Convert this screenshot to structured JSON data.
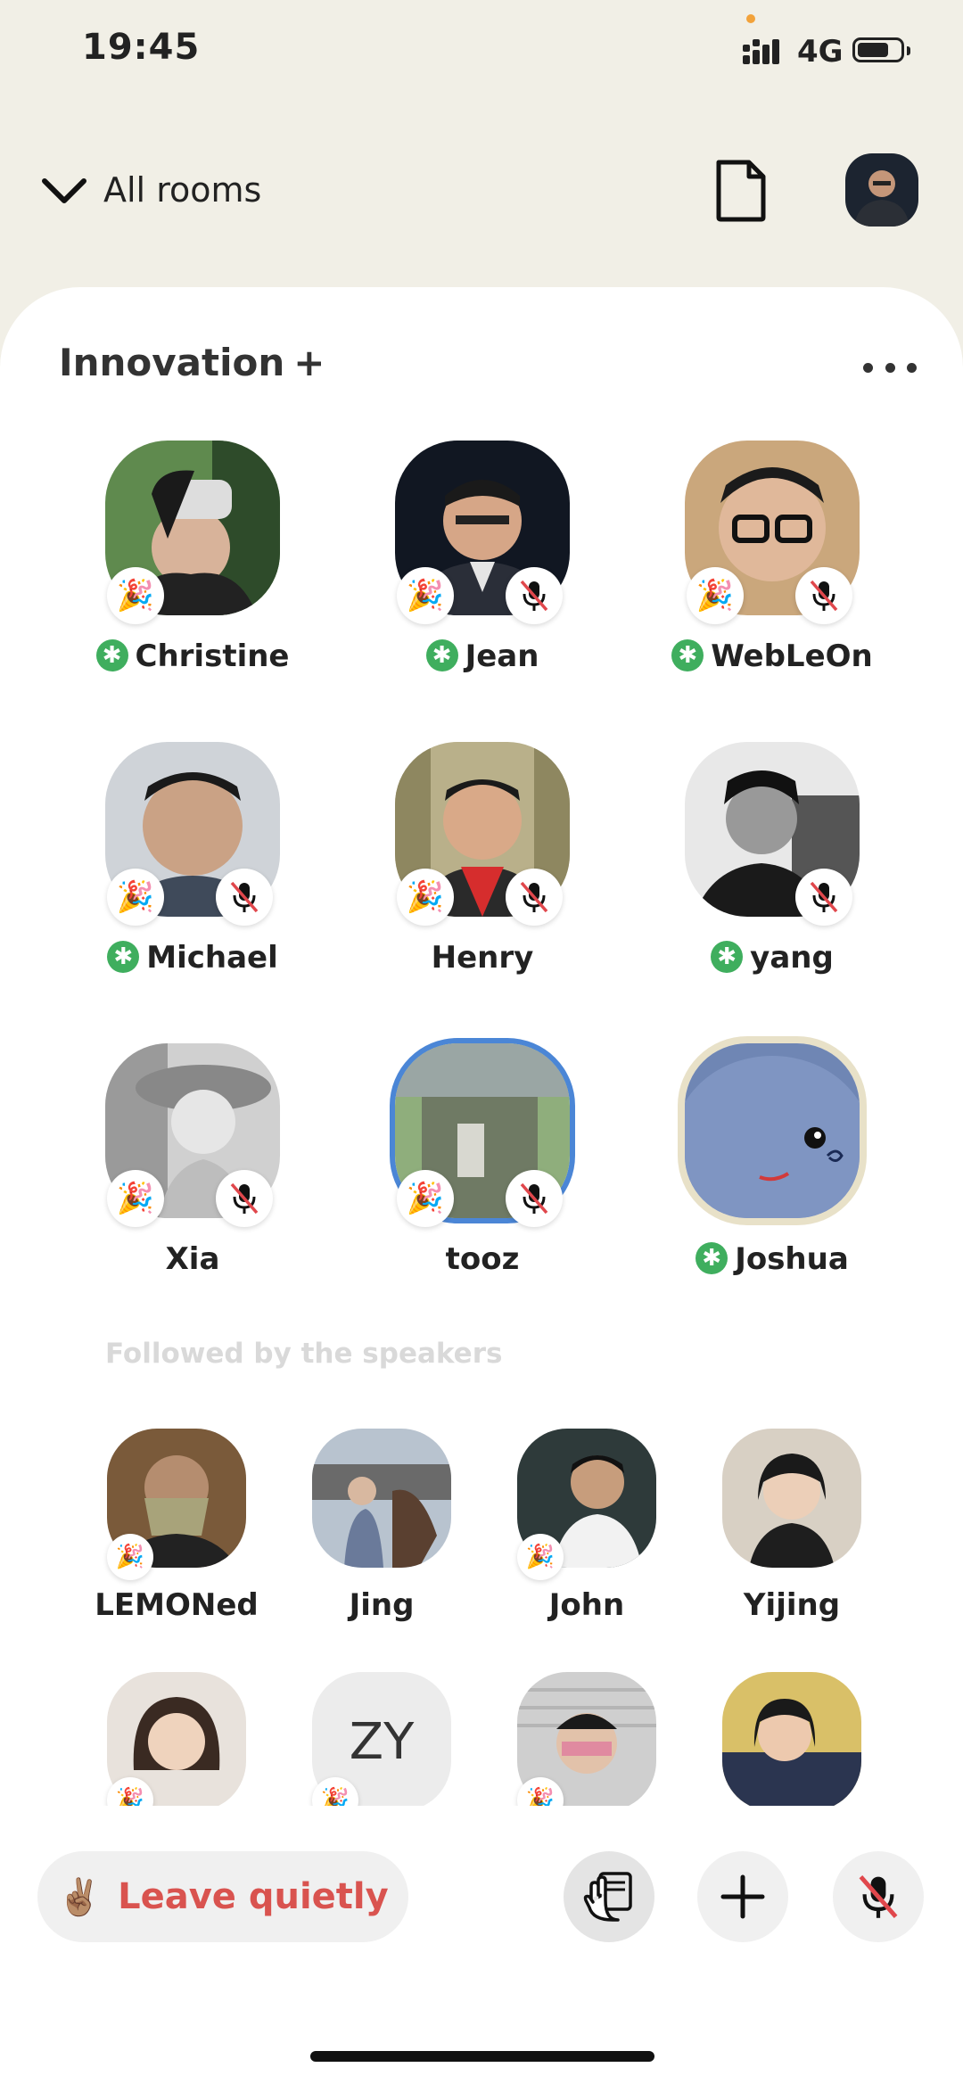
{
  "status_bar": {
    "time": "19:45",
    "network": "4G"
  },
  "header": {
    "back_label": "All rooms"
  },
  "room": {
    "title": "Innovation",
    "add_symbol": "+",
    "speakers": [
      {
        "name": "Christine",
        "moderator": true,
        "muted": false
      },
      {
        "name": "Jean",
        "moderator": true,
        "muted": true
      },
      {
        "name": "WebLeOn",
        "moderator": true,
        "muted": true
      },
      {
        "name": "Michael",
        "moderator": true,
        "muted": true
      },
      {
        "name": "Henry",
        "moderator": false,
        "muted": true
      },
      {
        "name": "yang",
        "moderator": true,
        "muted": true
      },
      {
        "name": "Xia",
        "moderator": false,
        "muted": true
      },
      {
        "name": "tooz",
        "moderator": false,
        "muted": true
      },
      {
        "name": "Joshua",
        "moderator": true,
        "muted": false
      }
    ],
    "followed_label": "Followed by the speakers",
    "listeners": [
      {
        "name": "LEMONed"
      },
      {
        "name": "Jing"
      },
      {
        "name": "John"
      },
      {
        "name": "Yijing"
      },
      {
        "name": ""
      },
      {
        "name": "",
        "initials": "ZY"
      },
      {
        "name": ""
      },
      {
        "name": ""
      }
    ]
  },
  "bottom_bar": {
    "leave_emoji": "✌🏽",
    "leave_label": "Leave quietly"
  },
  "colors": {
    "background": "#f1efe6",
    "moderator_green": "#3fae5e",
    "leave_red": "#d9534f",
    "mute_red": "#e0474c"
  }
}
